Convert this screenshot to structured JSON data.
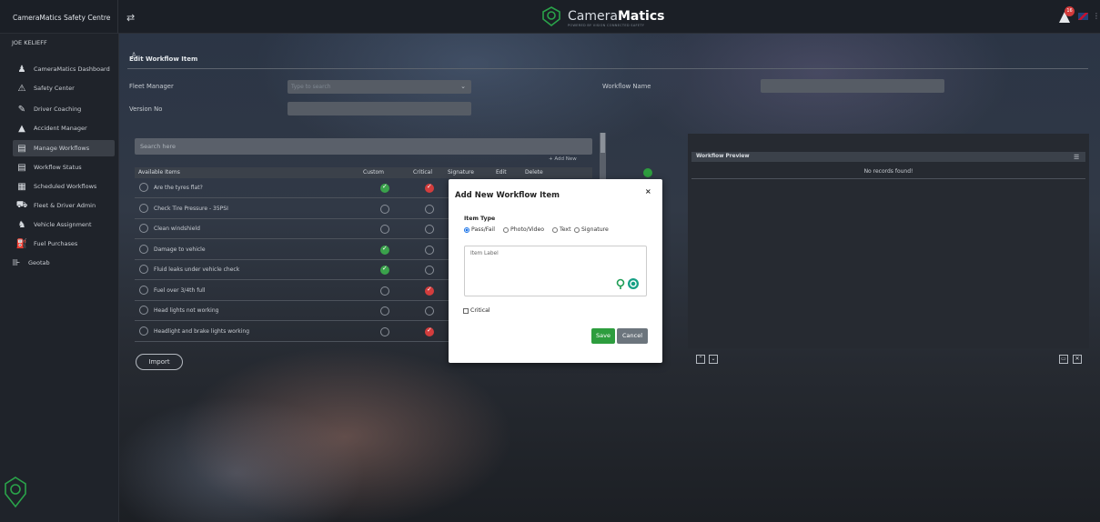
{
  "header": {
    "app_title": "CameraMatics Safety Centre",
    "logo_text": "Camera",
    "logo_text_bold": "Matics",
    "logo_sub": "POWERED BY VISION CONNECTED SAFETY",
    "notification_count": "16"
  },
  "sidebar": {
    "user": "JOE KELIEFF",
    "items": [
      {
        "label": "CameraMatics Dashboard",
        "icon": "dashboard-icon"
      },
      {
        "label": "Safety Center",
        "icon": "warning-icon"
      },
      {
        "label": "Driver Coaching",
        "icon": "coaching-icon"
      },
      {
        "label": "Accident Manager",
        "icon": "alert-icon"
      },
      {
        "label": "Manage Workflows",
        "icon": "clipboard-icon"
      },
      {
        "label": "Workflow Status",
        "icon": "clipboard-icon"
      },
      {
        "label": "Scheduled Workflows",
        "icon": "calendar-icon"
      },
      {
        "label": "Fleet & Driver Admin",
        "icon": "car-icon"
      },
      {
        "label": "Vehicle Assignment",
        "icon": "assign-icon"
      },
      {
        "label": "Fuel Purchases",
        "icon": "fuel-icon"
      },
      {
        "label": "Geotab",
        "icon": "geotab-icon"
      }
    ],
    "active_index": 4
  },
  "form": {
    "title": "Edit Workflow Item",
    "fleet_manager_label": "Fleet Manager",
    "fleet_manager_placeholder": "Type to search",
    "workflow_name_label": "Workflow Name",
    "version_label": "Version No"
  },
  "items_list": {
    "search_placeholder": "Search here",
    "add_new": "+ Add New",
    "columns": [
      "Available Items",
      "Custom",
      "Critical",
      "Signature",
      "Edit",
      "Delete"
    ],
    "rows": [
      {
        "label": "Are the tyres flat?",
        "custom": true,
        "critical": true
      },
      {
        "label": "Check Tire Pressure - 35PSI",
        "custom": false,
        "critical": false
      },
      {
        "label": "Clean windshield",
        "custom": false,
        "critical": false
      },
      {
        "label": "Damage to vehicle",
        "custom": true,
        "critical": false
      },
      {
        "label": "Fluid leaks under vehicle check",
        "custom": true,
        "critical": false
      },
      {
        "label": "Fuel over 3/4th full",
        "custom": false,
        "critical": true
      },
      {
        "label": "Head lights not working",
        "custom": false,
        "critical": false
      },
      {
        "label": "Headlight and brake lights working",
        "custom": false,
        "critical": true
      }
    ],
    "import_label": "Import"
  },
  "preview": {
    "title": "Workflow Preview",
    "empty_text": "No records found!"
  },
  "modal": {
    "title": "Add New Workflow Item",
    "close": "×",
    "item_type_label": "Item Type",
    "options": [
      "Pass/Fail",
      "Photo/Video",
      "Text",
      "Signature"
    ],
    "selected_option": "Pass/Fail",
    "item_label_placeholder": "Item Label",
    "critical_label": "Critical",
    "save_label": "Save",
    "cancel_label": "Cancel"
  },
  "colors": {
    "accent_green": "#2d9d3e",
    "critical_red": "#d33d3d",
    "cancel_gray": "#6c757d"
  }
}
